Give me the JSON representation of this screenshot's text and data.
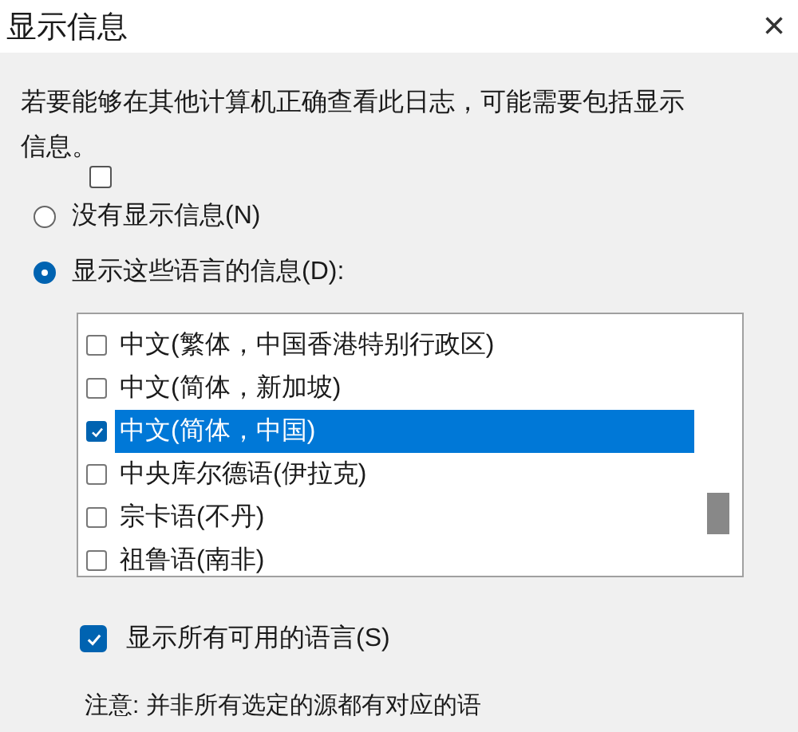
{
  "window": {
    "title": "显示信息",
    "close": "×"
  },
  "description": "若要能够在其他计算机正确查看此日志，可能需要包括显示信息。",
  "stray_checkbox": {
    "checked": false
  },
  "radios": [
    {
      "label": "没有显示信息(N)",
      "selected": false
    },
    {
      "label": "显示这些语言的信息(D):",
      "selected": true
    }
  ],
  "languages": [
    {
      "label": "中文(繁体，中国香港特别行政区)",
      "checked": false,
      "selected": false
    },
    {
      "label": "中文(简体，新加坡)",
      "checked": false,
      "selected": false
    },
    {
      "label": "中文(简体，中国)",
      "checked": true,
      "selected": true
    },
    {
      "label": "中央库尔德语(伊拉克)",
      "checked": false,
      "selected": false
    },
    {
      "label": "宗卡语(不丹)",
      "checked": false,
      "selected": false
    },
    {
      "label": "祖鲁语(南非)",
      "checked": false,
      "selected": false
    }
  ],
  "show_all": {
    "label": "显示所有可用的语言(S)",
    "checked": true
  },
  "note": "注意: 并非所有选定的源都有对应的语"
}
